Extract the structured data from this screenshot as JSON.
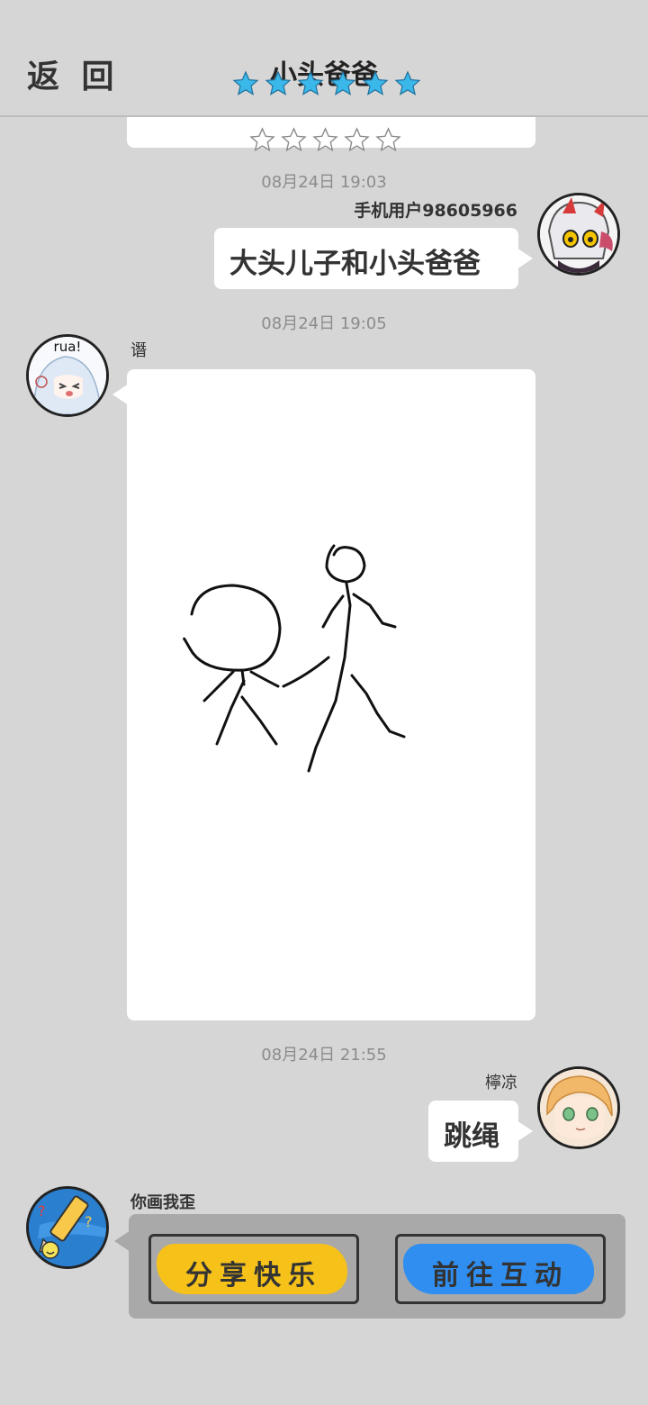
{
  "header": {
    "back_label": "返 回",
    "title": "小头爸爸",
    "rating_filled": 6,
    "star_color": "#3ab8ea"
  },
  "rating_outline": {
    "count": 5
  },
  "messages": [
    {
      "time": "08月24日  19:03",
      "user": "手机用户98605966",
      "text": "大头儿子和小头爸爸"
    },
    {
      "time": "08月24日  19:05",
      "user": "谮",
      "avatar_text": "rua!"
    },
    {
      "time": "08月24日  21:55",
      "user": "檸凉",
      "text": "跳绳"
    }
  ],
  "game": {
    "user": "你画我歪",
    "share_label": "分享快乐",
    "go_label": "前往互动",
    "share_color": "#f6c21a",
    "go_color": "#2f8ef0"
  }
}
